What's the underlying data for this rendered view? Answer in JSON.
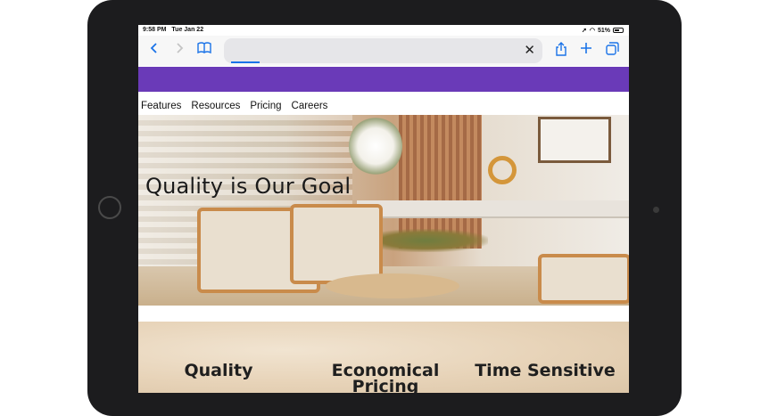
{
  "status_bar": {
    "time": "9:58 PM",
    "date": "Tue Jan 22",
    "battery": "51%"
  },
  "browser": {
    "back_icon": "chevron-left-icon",
    "forward_icon": "chevron-right-icon",
    "bookmarks_icon": "book-icon",
    "clear_icon": "close-icon",
    "share_icon": "share-icon",
    "new_tab_icon": "plus-icon",
    "tabs_icon": "tabs-icon",
    "accent_color": "#1a73e8"
  },
  "header": {
    "bar_color": "#6a3ab8"
  },
  "nav": {
    "items": [
      "Features",
      "Resources",
      "Pricing",
      "Careers"
    ]
  },
  "hero": {
    "title": "Quality is Our Goal"
  },
  "features": {
    "items": [
      "Quality",
      "Economical Pricing",
      "Time Sensitive"
    ]
  }
}
